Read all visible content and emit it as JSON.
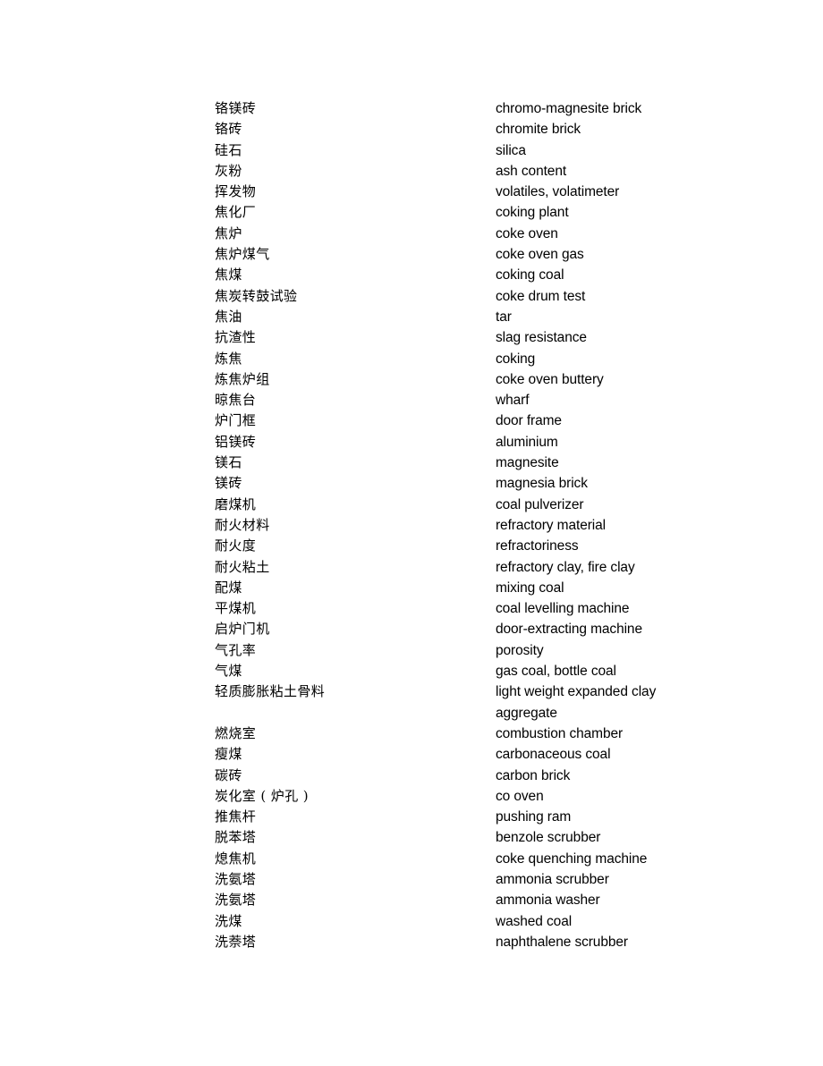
{
  "document": {
    "type": "bilingual-glossary",
    "page_background": "#ffffff",
    "text_color": "#000000",
    "columns": [
      "chinese",
      "english"
    ],
    "entries": [
      {
        "cn": "铬镁砖",
        "en": "chromo-magnesite brick"
      },
      {
        "cn": "铬砖",
        "en": "chromite brick"
      },
      {
        "cn": "硅石",
        "en": "silica"
      },
      {
        "cn": "灰粉",
        "en": "ash content"
      },
      {
        "cn": "挥发物",
        "en": "volatiles, volatimeter"
      },
      {
        "cn": "焦化厂",
        "en": "coking plant"
      },
      {
        "cn": "焦炉",
        "en": "coke oven"
      },
      {
        "cn": "焦炉煤气",
        "en": "coke oven gas"
      },
      {
        "cn": "焦煤",
        "en": "coking coal"
      },
      {
        "cn": "焦炭转鼓试验",
        "en": "coke drum test"
      },
      {
        "cn": "焦油",
        "en": "tar"
      },
      {
        "cn": "抗渣性",
        "en": "slag resistance"
      },
      {
        "cn": "炼焦",
        "en": "coking"
      },
      {
        "cn": "炼焦炉组",
        "en": "coke oven buttery"
      },
      {
        "cn": "晾焦台",
        "en": "wharf"
      },
      {
        "cn": "炉门框",
        "en": "door frame"
      },
      {
        "cn": "铝镁砖",
        "en": "aluminium"
      },
      {
        "cn": "镁石",
        "en": "magnesite"
      },
      {
        "cn": "镁砖",
        "en": "magnesia brick"
      },
      {
        "cn": "磨煤机",
        "en": "coal pulverizer"
      },
      {
        "cn": "耐火材料",
        "en": "refractory material"
      },
      {
        "cn": "耐火度",
        "en": "refractoriness"
      },
      {
        "cn": "耐火粘土",
        "en": "refractory clay, fire clay"
      },
      {
        "cn": "配煤",
        "en": "mixing coal"
      },
      {
        "cn": "平煤机",
        "en": "coal levelling machine"
      },
      {
        "cn": "启炉门机",
        "en": "door-extracting machine"
      },
      {
        "cn": "气孔率",
        "en": "porosity"
      },
      {
        "cn": "气煤",
        "en": "gas coal, bottle coal"
      },
      {
        "cn": "轻质膨胀粘土骨料",
        "en": "light weight expanded clay"
      },
      {
        "cn": "",
        "en": "aggregate"
      },
      {
        "cn": "燃烧室",
        "en": "combustion chamber"
      },
      {
        "cn": "瘦煤",
        "en": "carbonaceous coal"
      },
      {
        "cn": "碳砖",
        "en": "carbon brick"
      },
      {
        "cn": "炭化室 ( 炉孔 )",
        "en": "co oven"
      },
      {
        "cn": "推焦杆",
        "en": "pushing ram"
      },
      {
        "cn": "脱苯塔",
        "en": "benzole scrubber"
      },
      {
        "cn": "熄焦机",
        "en": "coke quenching machine"
      },
      {
        "cn": "洗氨塔",
        "en": "ammonia scrubber"
      },
      {
        "cn": "洗氨塔",
        "en": "ammonia washer"
      },
      {
        "cn": "洗煤",
        "en": "washed coal"
      },
      {
        "cn": "洗萘塔",
        "en": "naphthalene scrubber"
      }
    ]
  }
}
